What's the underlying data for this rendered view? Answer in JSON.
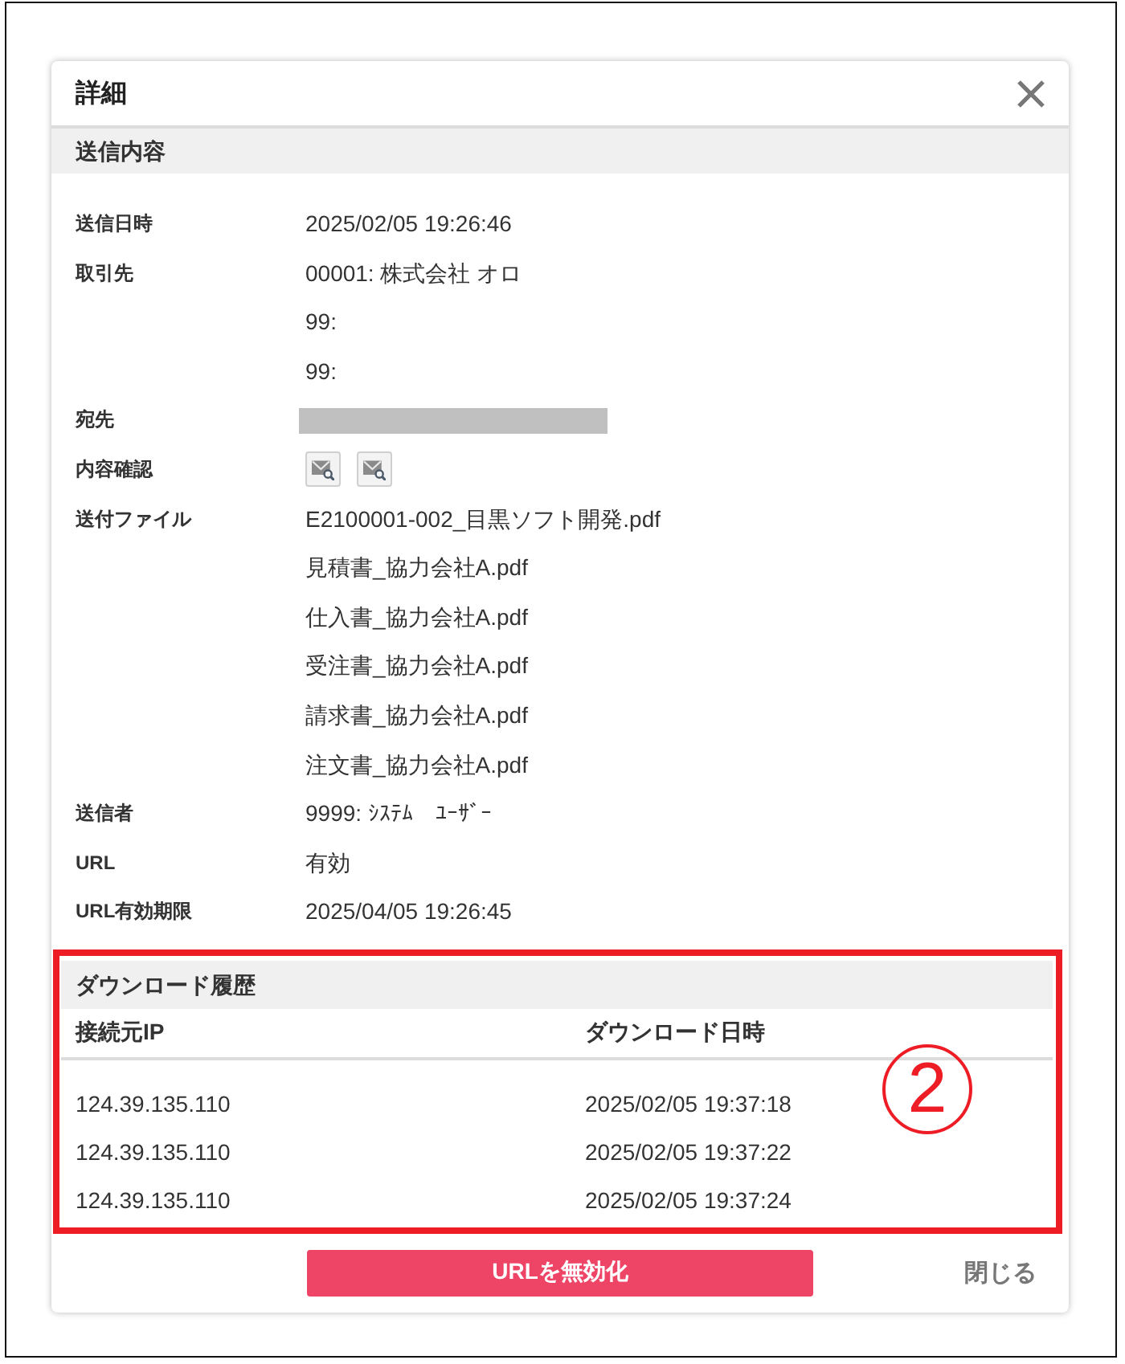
{
  "dialog": {
    "title": "詳細"
  },
  "send_details": {
    "heading": "送信内容",
    "rows": [
      {
        "label": "送信日時",
        "kind": "text",
        "values": [
          "2025/02/05 19:26:46"
        ]
      },
      {
        "label": "取引先",
        "kind": "text",
        "values": [
          "00001: 株式会社 オロ",
          "99:",
          "99:"
        ]
      },
      {
        "label": "宛先",
        "kind": "redacted"
      },
      {
        "label": "内容確認",
        "kind": "buttons",
        "buttons": [
          {
            "kind": "preview"
          },
          {
            "kind": "preview"
          }
        ]
      },
      {
        "label": "送付ファイル",
        "kind": "text",
        "values": [
          "E2100001-002_目黒ソフト開発.pdf",
          "見積書_協力会社A.pdf",
          "仕入書_協力会社A.pdf",
          "受注書_協力会社A.pdf",
          "請求書_協力会社A.pdf",
          "注文書_協力会社A.pdf"
        ]
      },
      {
        "label": "送信者",
        "kind": "text",
        "values": [
          "9999: ｼｽﾃﾑ　ﾕｰｻﾞｰ"
        ]
      },
      {
        "label": "URL",
        "kind": "text",
        "values": [
          "有効"
        ]
      },
      {
        "label": "URL有効期限",
        "kind": "text",
        "values": [
          "2025/04/05 19:26:45"
        ]
      }
    ]
  },
  "download_history": {
    "heading": "ダウンロード履歴",
    "highlighted": true,
    "callout": "2",
    "columns": [
      "接続元IP",
      "ダウンロード日時"
    ],
    "rows": [
      [
        "124.39.135.110",
        "2025/02/05 19:37:18"
      ],
      [
        "124.39.135.110",
        "2025/02/05 19:37:22"
      ],
      [
        "124.39.135.110",
        "2025/02/05 19:37:24"
      ]
    ]
  },
  "footer_buttons": [
    {
      "kind": "primary",
      "label": "URLを無効化"
    },
    {
      "kind": "link",
      "label": "閉じる"
    }
  ]
}
